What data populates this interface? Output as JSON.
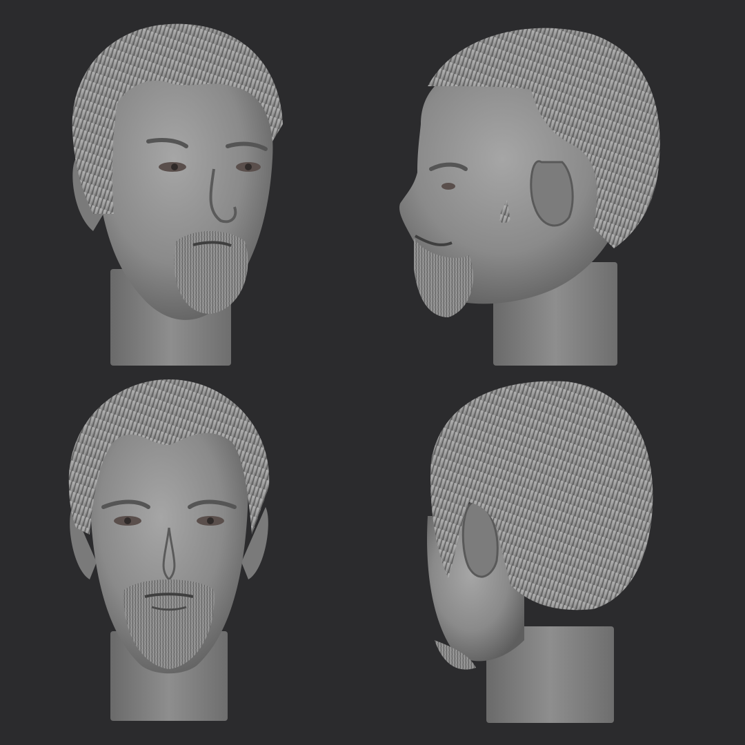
{
  "scene": {
    "background_color": "#2b2b2d",
    "clay_color": "#8e8e8e",
    "views": [
      {
        "id": "front-three-quarter",
        "icon": "sculpt-head-front-three-quarter"
      },
      {
        "id": "profile-left",
        "icon": "sculpt-head-profile"
      },
      {
        "id": "front",
        "icon": "sculpt-head-front"
      },
      {
        "id": "back-three-quarter",
        "icon": "sculpt-head-back-three-quarter"
      }
    ]
  }
}
